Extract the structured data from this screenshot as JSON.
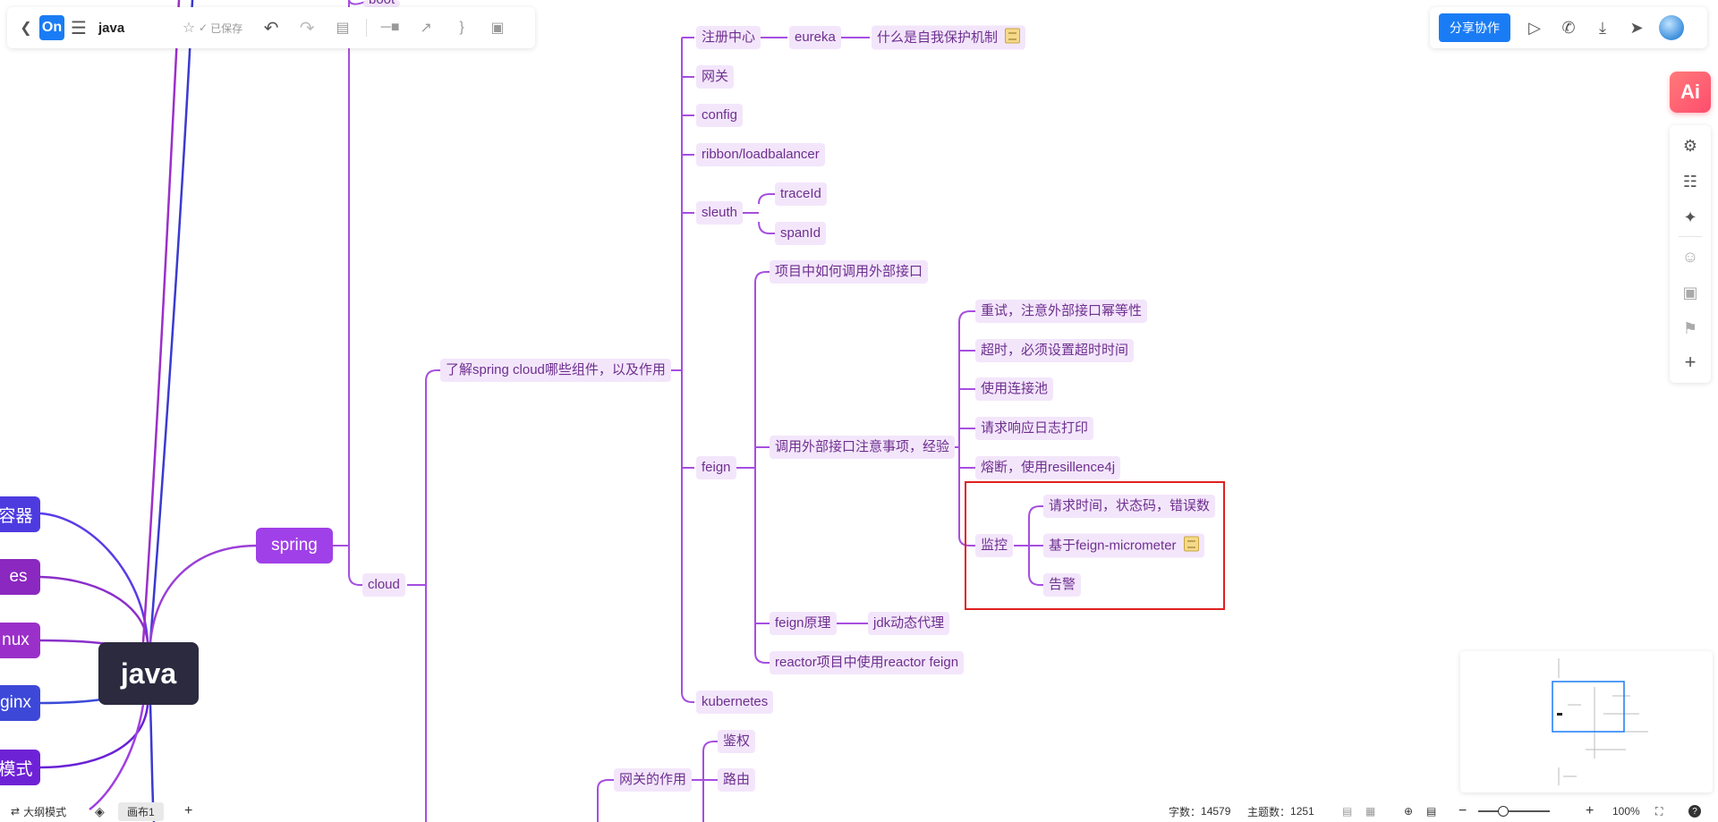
{
  "toolbar": {
    "logo_text": "On",
    "doc_title": "java",
    "saved_status": "已保存",
    "icons": [
      "back-icon",
      "menu-icon",
      "star-icon",
      "saved-check-icon",
      "undo-icon",
      "redo-icon",
      "format-painter-icon",
      "relation-icon",
      "connector-icon",
      "summary-icon",
      "boundary-icon"
    ]
  },
  "top_right": {
    "share_label": "分享协作",
    "icons": [
      "present-icon",
      "call-icon",
      "download-icon",
      "send-icon",
      "avatar"
    ]
  },
  "ai_label": "Ai",
  "side_panel_icons": [
    "style-icon",
    "structure-icon",
    "magic-icon",
    "emoji-icon",
    "image-icon",
    "tag-icon",
    "add-icon"
  ],
  "mindmap": {
    "root": "java",
    "left_branches": [
      "容器",
      "es",
      "nux",
      "ginx",
      "模式"
    ],
    "spring": "spring",
    "boot_partial": "boot",
    "cloud": "cloud",
    "understand": "了解spring cloud哪些组件，以及作用",
    "registry": "注册中心",
    "eureka": "eureka",
    "self_protect": "什么是自我保护机制",
    "gateway": "网关",
    "config": "config",
    "ribbon": "ribbon/loadbalancer",
    "sleuth": "sleuth",
    "traceid": "traceId",
    "spanid": "spanId",
    "feign": "feign",
    "how_call": "项目中如何调用外部接口",
    "call_notes": "调用外部接口注意事项，经验",
    "retry": "重试，注意外部接口幂等性",
    "timeout": "超时，必须设置超时时间",
    "pool": "使用连接池",
    "log": "请求响应日志打印",
    "circuit": "熔断，使用resillence4j",
    "monitor": "监控",
    "metrics": "请求时间，状态码，错误数",
    "micrometer": "基于feign-micrometer",
    "alert": "告警",
    "feign_principle": "feign原理",
    "jdk_proxy": "jdk动态代理",
    "reactor": "reactor项目中使用reactor feign",
    "kubernetes": "kubernetes",
    "gateway_role": "网关的作用",
    "auth": "鉴权",
    "routing": "路由"
  },
  "bottom": {
    "outline_mode": "大纲模式",
    "canvas_tab": "画布1",
    "word_count_label": "字数：",
    "word_count": "14579",
    "topic_count_label": "主题数：",
    "topic_count": "1251",
    "zoom": "100%",
    "help": "?"
  },
  "colors": {
    "branch_purple": "#9b3fd6",
    "node_text": "#6e2f8f",
    "node_bg": "#f3e6fb",
    "root_bg": "#2b2a3f",
    "accent_blue": "#1a7cf5",
    "highlight_red": "#e02020"
  }
}
